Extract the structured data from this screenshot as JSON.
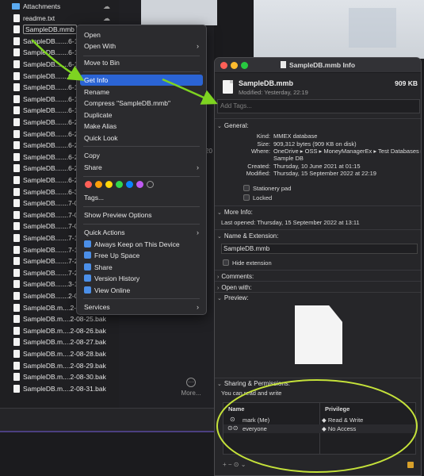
{
  "finder": {
    "files": [
      {
        "name": "Attachments",
        "type": "folder",
        "cloud": true
      },
      {
        "name": "readme.txt",
        "type": "file",
        "cloud": true
      },
      {
        "name": "SampleDB.mmb",
        "type": "file",
        "selected": true
      },
      {
        "name": "SampleDB.......6-1",
        "type": "file"
      },
      {
        "name": "SampleDB.......6-1",
        "type": "file"
      },
      {
        "name": "SampleDB.......6-1",
        "type": "file"
      },
      {
        "name": "SampleDB.......6-1",
        "type": "file"
      },
      {
        "name": "SampleDB.......6-1",
        "type": "file"
      },
      {
        "name": "SampleDB.......6-1",
        "type": "file"
      },
      {
        "name": "SampleDB.......6-1",
        "type": "file"
      },
      {
        "name": "SampleDB.......6-2",
        "type": "file"
      },
      {
        "name": "SampleDB.......6-2",
        "type": "file"
      },
      {
        "name": "SampleDB.......6-2",
        "type": "file"
      },
      {
        "name": "SampleDB.......6-2",
        "type": "file"
      },
      {
        "name": "SampleDB.......6-2",
        "type": "file"
      },
      {
        "name": "SampleDB.......6-2",
        "type": "file"
      },
      {
        "name": "SampleDB.......6-3",
        "type": "file"
      },
      {
        "name": "SampleDB.......7-0",
        "type": "file"
      },
      {
        "name": "SampleDB.......7-0",
        "type": "file"
      },
      {
        "name": "SampleDB.......7-0",
        "type": "file"
      },
      {
        "name": "SampleDB.......7-1",
        "type": "file"
      },
      {
        "name": "SampleDB.......7-1",
        "type": "file"
      },
      {
        "name": "SampleDB.......7-2",
        "type": "file"
      },
      {
        "name": "SampleDB.......7-2",
        "type": "file"
      },
      {
        "name": "SampleDB.......3-1",
        "type": "file"
      },
      {
        "name": "SampleDB.......2-0",
        "type": "file"
      },
      {
        "name": "SampleDB.m....2-08-24.bak",
        "type": "file"
      },
      {
        "name": "SampleDB.m....2-08-25.bak",
        "type": "file"
      },
      {
        "name": "SampleDB.m....2-08-26.bak",
        "type": "file"
      },
      {
        "name": "SampleDB.m....2-08-27.bak",
        "type": "file"
      },
      {
        "name": "SampleDB.m....2-08-28.bak",
        "type": "file"
      },
      {
        "name": "SampleDB.m....2-08-29.bak",
        "type": "file"
      },
      {
        "name": "SampleDB.m....2-08-30.bak",
        "type": "file"
      },
      {
        "name": "SampleDB.m....2-08-31.bak",
        "type": "file"
      }
    ],
    "more_label": "More...",
    "more_glyph": "···",
    "cloud_glyph": "☁",
    "side_fragment": "20"
  },
  "context_menu": {
    "open": "Open",
    "open_with": "Open With",
    "move_to_bin": "Move to Bin",
    "get_info": "Get Info",
    "rename": "Rename",
    "compress": "Compress \"SampleDB.mmb\"",
    "duplicate": "Duplicate",
    "make_alias": "Make Alias",
    "quick_look": "Quick Look",
    "copy": "Copy",
    "share": "Share",
    "tags": "Tags...",
    "show_preview_options": "Show Preview Options",
    "quick_actions": "Quick Actions",
    "always_keep": "Always Keep on This Device",
    "free_up_space": "Free Up Space",
    "share_action": "Share",
    "version_history": "Version History",
    "view_online": "View Online",
    "services": "Services",
    "chevron": "›",
    "tag_colors": [
      "#ff5f57",
      "#ff9f0a",
      "#ffd60a",
      "#32d74b",
      "#0a84ff",
      "#bf5af2",
      "none"
    ]
  },
  "info_window": {
    "title": "SampleDB.mmb Info",
    "file_name": "SampleDB.mmb",
    "file_size": "909 KB",
    "modified_short": "Modified: Yesterday, 22:19",
    "tags_placeholder": "Add Tags...",
    "general": {
      "header": "General:",
      "kind_label": "Kind:",
      "kind": "MMEX database",
      "size_label": "Size:",
      "size": "909,312 bytes (909 KB on disk)",
      "where_label": "Where:",
      "where_line1": "OneDrive ▸ OSS ▸ MoneyManagerEx ▸ Test Databases ▸",
      "where_line2": "Sample DB",
      "created_label": "Created:",
      "created": "Thursday, 10 June 2021 at 01:15",
      "modified_label": "Modified:",
      "modified": "Thursday, 15 September 2022 at 22:19",
      "stationery_pad": "Stationery pad",
      "locked": "Locked"
    },
    "more_info": {
      "header": "More Info:",
      "last_opened": "Last opened: Thursday, 15 September 2022 at 13:11"
    },
    "name_ext": {
      "header": "Name & Extension:",
      "value": "SampleDB.mmb",
      "hide_extension": "Hide extension"
    },
    "comments_header": "Comments:",
    "open_with_header": "Open with:",
    "preview_header": "Preview:",
    "sharing": {
      "header": "Sharing & Permissions:",
      "note": "You can read and write",
      "col_name": "Name",
      "col_privilege": "Privilege",
      "rows": [
        {
          "name": "mark (Me)",
          "privilege": "Read & Write"
        },
        {
          "name": "everyone",
          "privilege": "No Access"
        }
      ],
      "buttons": "+ − ⊙ ⌄"
    }
  },
  "annotation_colors": {
    "arrow": "#7ed321",
    "ellipse": "#c5e23a"
  }
}
